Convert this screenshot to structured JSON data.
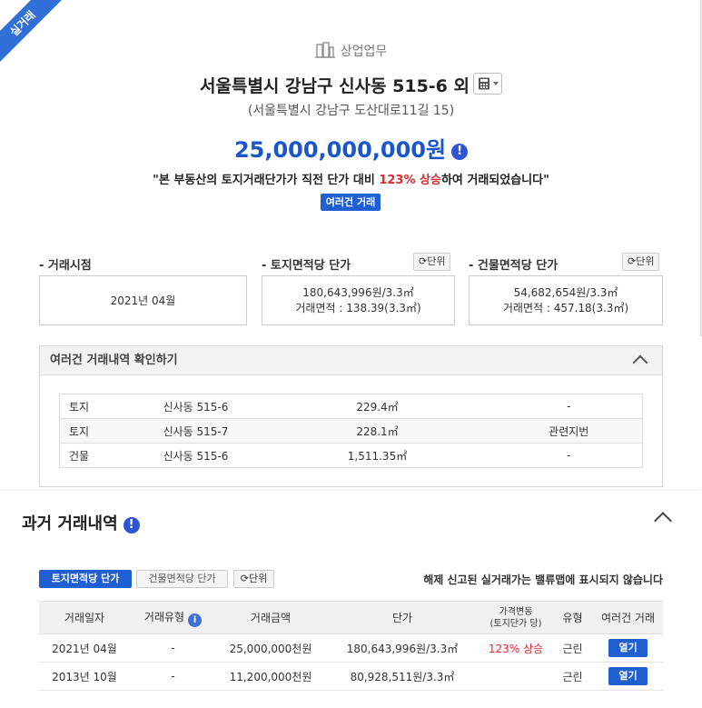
{
  "ribbon": "실거래",
  "category": "상업업무",
  "address": "서울특별시 강남구 신사동 515-6 외",
  "road_address": "(서울특별시 강남구 도산대로11길 15)",
  "price": "25,000,000,000원",
  "notice": {
    "prefix": "\"본 부동산의 토지거래단가가 직전 단가 대비 ",
    "rise": "123% 상승",
    "suffix": "하여 거래되었습니다\""
  },
  "multi_badge": "여러건 거래",
  "sections": {
    "deal_time": {
      "label": "- 거래시점",
      "value": "2021년 04월"
    },
    "land_unit": {
      "label": "- 토지면적당 단가",
      "unit_btn": "단위",
      "line1": "180,643,996원/3.3㎡",
      "line2": "거래면적 : 138.39(3.3㎡)"
    },
    "bldg_unit": {
      "label": "- 건물면적당 단가",
      "unit_btn": "단위",
      "line1": "54,682,654원/3.3㎡",
      "line2": "거래면적 : 457.18(3.3㎡)"
    }
  },
  "multi_detail": {
    "title": "여러건 거래내역 확인하기",
    "rows": [
      {
        "type": "토지",
        "addr": "신사동 515-6",
        "area": "229.4㎡",
        "note": "-"
      },
      {
        "type": "토지",
        "addr": "신사동 515-7",
        "area": "228.1㎡",
        "note": "관련지번"
      },
      {
        "type": "건물",
        "addr": "신사동 515-6",
        "area": "1,511.35㎡",
        "note": "-"
      }
    ]
  },
  "past": {
    "title": "과거 거래내역",
    "tab_land": "토지면적당 단가",
    "tab_bldg": "건물면적당 단가",
    "tab_unit": "단위",
    "disclaimer": "해제 신고된 실거래가는 밸류맵에 표시되지 않습니다",
    "headers": {
      "date": "거래일자",
      "type": "거래유형",
      "amount": "거래금액",
      "unit_price": "단가",
      "change_1": "가격변동",
      "change_2": "(토지단가 당)",
      "kind": "유형",
      "multi": "여러건 거래"
    },
    "rows": [
      {
        "date": "2021년 04월",
        "type": "-",
        "amount": "25,000,000천원",
        "unit_price": "180,643,996원/3.3㎡",
        "change": "123% 상승",
        "kind": "근린",
        "open": "열기"
      },
      {
        "date": "2013년 10월",
        "type": "-",
        "amount": "11,200,000천원",
        "unit_price": "80,928,511원/3.3㎡",
        "change": "",
        "kind": "근린",
        "open": "열기"
      }
    ]
  },
  "colors": {
    "accent": "#1f5fd1",
    "rise": "#e0282e"
  }
}
